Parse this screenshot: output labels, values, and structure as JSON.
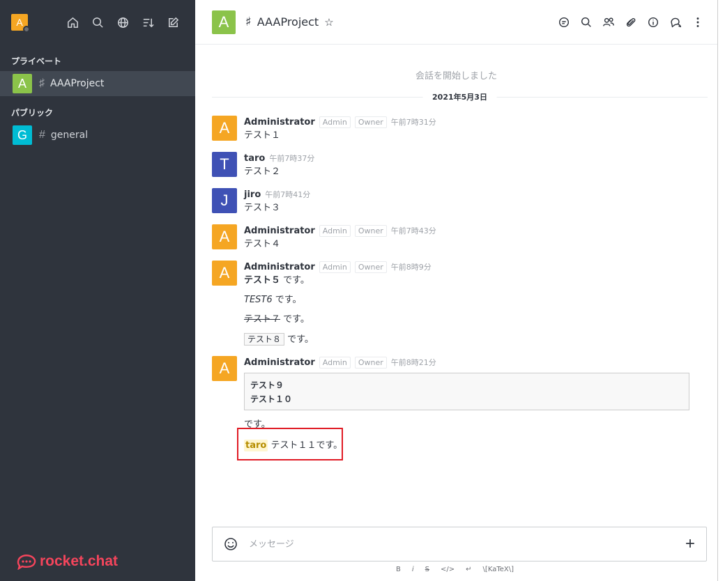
{
  "user": {
    "avatar_letter": "A"
  },
  "sidebar": {
    "sections": [
      {
        "label": "プライベート"
      },
      {
        "label": "パブリック"
      }
    ],
    "rooms": [
      {
        "letter": "A",
        "icon": "lock-hash-icon",
        "name": "AAAProject",
        "color": "#8bc34a",
        "active": true
      },
      {
        "letter": "G",
        "icon": "hash-icon",
        "name": "general",
        "color": "#00bcd4",
        "active": false
      }
    ],
    "logo_text": "rocket.chat"
  },
  "room": {
    "letter": "A",
    "name": "AAAProject",
    "color": "#8bc34a"
  },
  "conversation": {
    "start_text": "会話を開始しました",
    "date": "2021年5月3日"
  },
  "messages": [
    {
      "letter": "A",
      "color": "#f5a623",
      "name": "Administrator",
      "tags": [
        "Admin",
        "Owner"
      ],
      "time": "午前7時31分",
      "text": "テスト１"
    },
    {
      "letter": "T",
      "color": "#3f51b5",
      "name": "taro",
      "tags": [],
      "time": "午前7時37分",
      "text": "テスト２"
    },
    {
      "letter": "J",
      "color": "#3f51b5",
      "name": "jiro",
      "tags": [],
      "time": "午前7時41分",
      "text": "テスト３"
    },
    {
      "letter": "A",
      "color": "#f5a623",
      "name": "Administrator",
      "tags": [
        "Admin",
        "Owner"
      ],
      "time": "午前7時43分",
      "text": "テスト４"
    },
    {
      "letter": "A",
      "color": "#f5a623",
      "name": "Administrator",
      "tags": [
        "Admin",
        "Owner"
      ],
      "time": "午前8時9分",
      "bold": "テスト５",
      "bold_suffix": " です。",
      "italic": "TEST6",
      "italic_suffix": " です。",
      "strike": "テスト７",
      "strike_suffix": " です。",
      "code": "テスト８",
      "code_suffix": " です。"
    },
    {
      "letter": "A",
      "color": "#f5a623",
      "name": "Administrator",
      "tags": [
        "Admin",
        "Owner"
      ],
      "time": "午前8時21分",
      "code_lines": [
        "テスト９",
        "テスト１０"
      ],
      "after_code": "です。",
      "mention": "taro",
      "mention_text": " テスト１１です。"
    }
  ],
  "composer": {
    "placeholder": "メッセージ"
  },
  "format_bar": [
    "B",
    "i",
    "S",
    "</>",
    "↵",
    "\\[KaTeX\\]"
  ],
  "accent_colors": {
    "sidebar_bg": "#2f343d",
    "logo": "#f5455c",
    "highlight": "#e01b24"
  }
}
